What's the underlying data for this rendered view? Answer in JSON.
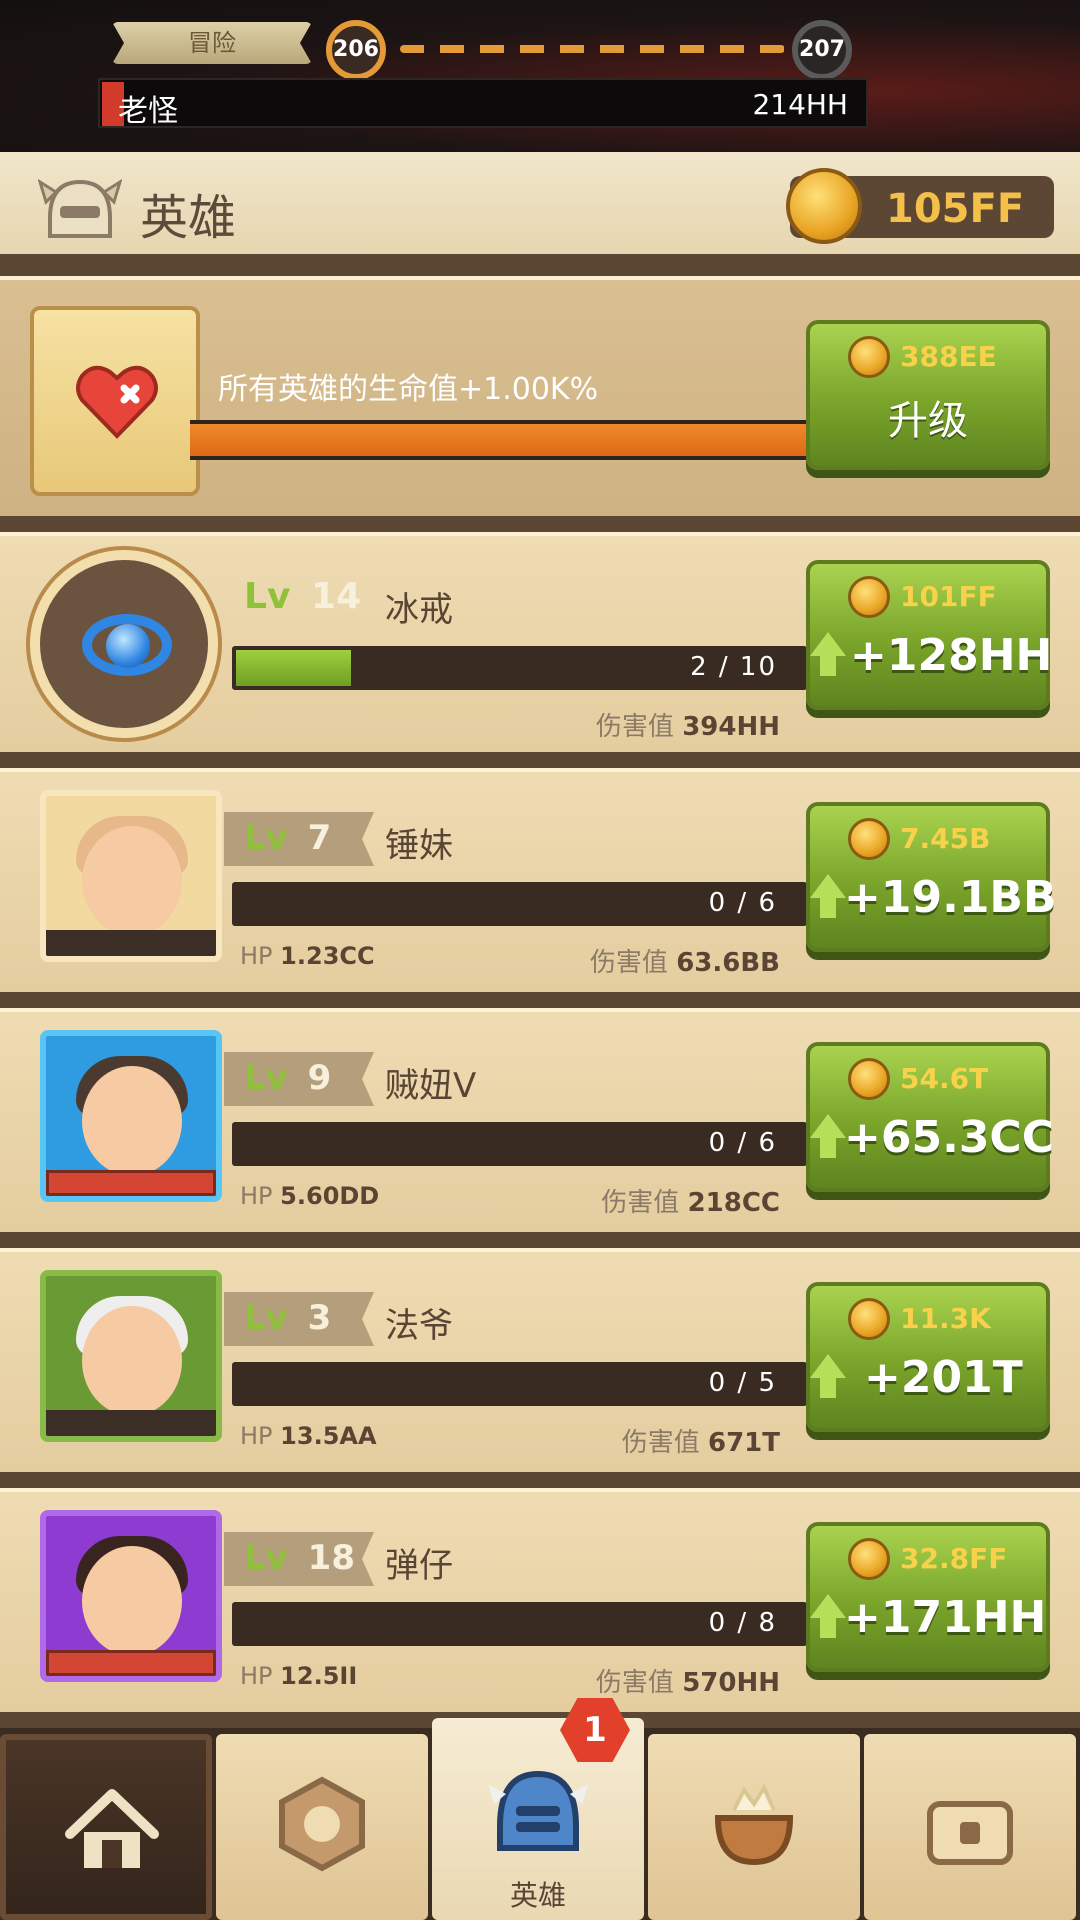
{
  "stage": {
    "mode_label": "冒险",
    "current": "206",
    "next": "207",
    "boss_name": "老怪",
    "boss_hp": "214HH"
  },
  "header": {
    "title": "英雄",
    "gold": "105FF"
  },
  "upgrade": {
    "description": "所有英雄的生命值+1.00K%",
    "cost": "388EE",
    "button_label": "升级",
    "progress": 1.0
  },
  "artifact": {
    "lv_prefix": "Lv",
    "level": "14",
    "name": "冰戒",
    "progress_text": "2 / 10",
    "progress": 0.2,
    "damage_label": "伤害值",
    "damage": "394HH",
    "cost": "101FF",
    "gain": "+128HH"
  },
  "heroes": [
    {
      "level": "7",
      "name": "锤妹",
      "progress_text": "0 / 6",
      "progress": 0,
      "hp_label": "HP",
      "hp": "1.23CC",
      "damage_label": "伤害值",
      "damage": "63.6BB",
      "cost": "7.45B",
      "gain": "+19.1BB"
    },
    {
      "level": "9",
      "name": "贼妞V",
      "progress_text": "0 / 6",
      "progress": 0,
      "hp_label": "HP",
      "hp": "5.60DD",
      "damage_label": "伤害值",
      "damage": "218CC",
      "cost": "54.6T",
      "gain": "+65.3CC"
    },
    {
      "level": "3",
      "name": "法爷",
      "progress_text": "0 / 5",
      "progress": 0,
      "hp_label": "HP",
      "hp": "13.5AA",
      "damage_label": "伤害值",
      "damage": "671T",
      "cost": "11.3K",
      "gain": "+201T"
    },
    {
      "level": "18",
      "name": "弹仔",
      "progress_text": "0 / 8",
      "progress": 0,
      "hp_label": "HP",
      "hp": "12.5II",
      "damage_label": "伤害值",
      "damage": "570HH",
      "cost": "32.8FF",
      "gain": "+171HH"
    }
  ],
  "nav": {
    "active_label": "英雄",
    "badge": "1",
    "items": [
      "home-icon",
      "rune-icon",
      "helmet-icon",
      "cauldron-icon",
      "chest-icon"
    ]
  },
  "colors": {
    "accent_green": "#8fc23a",
    "gold": "#f4c04a",
    "progress_orange": "#e97a1e",
    "badge_red": "#e3402c"
  }
}
